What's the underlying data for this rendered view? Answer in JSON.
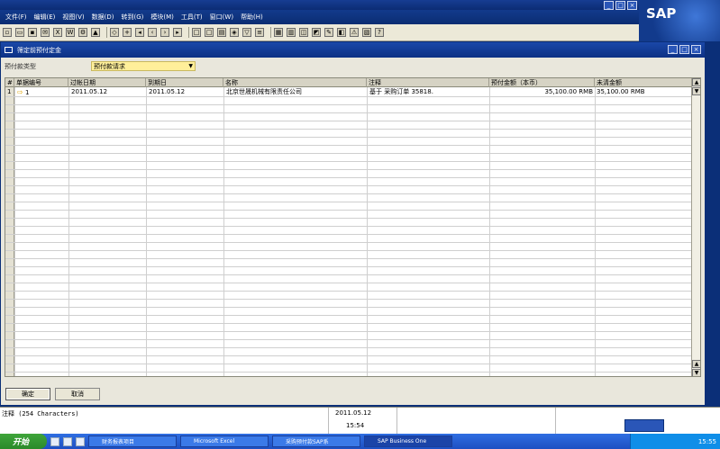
{
  "menu": [
    "文件(F)",
    "编辑(E)",
    "视图(V)",
    "数据(D)",
    "转到(G)",
    "模块(M)",
    "工具(T)",
    "窗口(W)",
    "帮助(H)"
  ],
  "logo": "SAP",
  "window": {
    "title": "筛定前预付定金"
  },
  "payment_type": {
    "label": "预付款类型",
    "value": "预付款请求"
  },
  "table": {
    "headers": [
      "#",
      "单据编号",
      "过帐日期",
      "到期日",
      "名称",
      "注释",
      "预付金额（本币）",
      "未清金额"
    ],
    "rows": [
      {
        "num": "1",
        "doc": "1",
        "posting_date": "2011.05.12",
        "due_date": "2011.05.12",
        "name": "北京世晟机械有限责任公司",
        "remarks": "基于 采购订单 35818.",
        "amount_lc": "35,100.00 RMB",
        "open_amount": "35,100.00 RMB"
      }
    ]
  },
  "buttons": {
    "ok": "确定",
    "cancel": "取消"
  },
  "status": {
    "text": "注释 (254 Characters)",
    "date": "2011.05.12",
    "time": "15:54"
  },
  "taskbar": {
    "start": "开始",
    "tasks": [
      "财务报表项目",
      "Microsoft Excel",
      "采购预付款SAP系",
      "SAP Business One"
    ],
    "clock": "15:55"
  }
}
